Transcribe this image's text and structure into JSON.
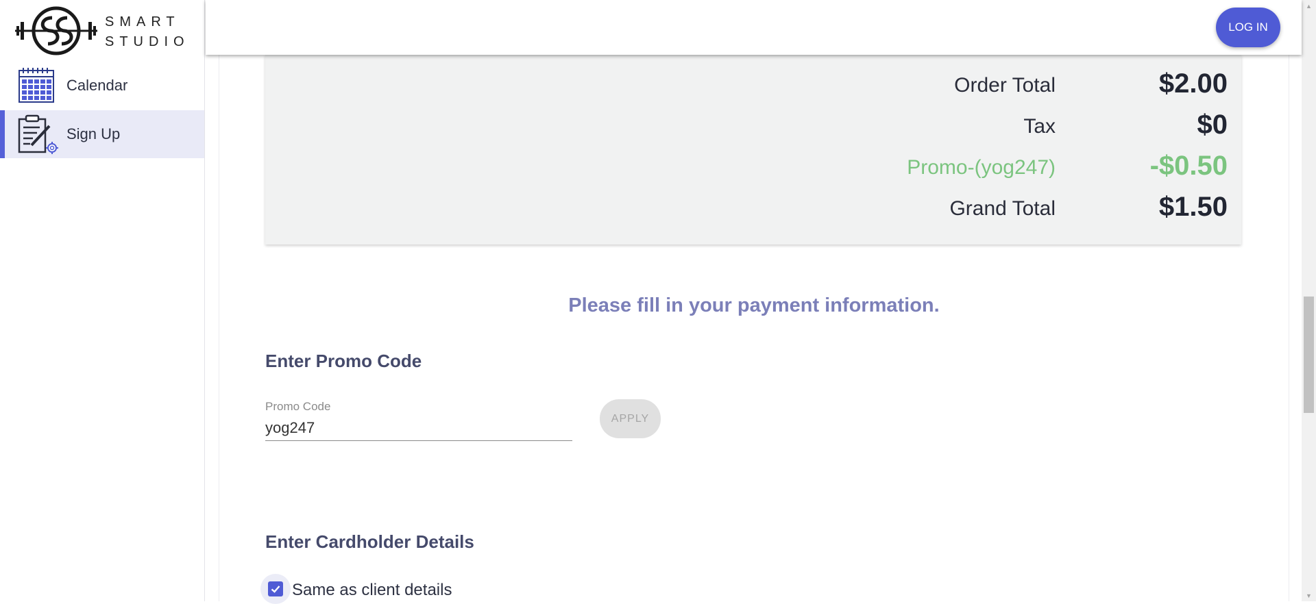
{
  "brand": {
    "logo_text_line1": "SMART",
    "logo_text_line2": "STUDIO"
  },
  "sidebar": {
    "items": [
      {
        "label": "Calendar",
        "icon": "calendar-icon",
        "active": false
      },
      {
        "label": "Sign Up",
        "icon": "clipboard-settings-icon",
        "active": true
      }
    ]
  },
  "header": {
    "login_label": "LOG IN"
  },
  "summary": {
    "order_total_label": "Order Total",
    "order_total_value": "$2.00",
    "tax_label": "Tax",
    "tax_value": "$0",
    "promo_label": "Promo-(yog247)",
    "promo_value": "-$0.50",
    "grand_total_label": "Grand Total",
    "grand_total_value": "$1.50"
  },
  "payment": {
    "title": "Please fill in your payment information.",
    "promo_section_heading": "Enter Promo Code",
    "promo_field_label": "Promo Code",
    "promo_field_value": "yog247",
    "apply_label": "APPLY",
    "cardholder_heading": "Enter Cardholder Details",
    "same_as_client_label": "Same as client details",
    "same_as_client_checked": true
  },
  "colors": {
    "accent": "#4f5bd5",
    "promo_green": "#7bc47f",
    "title_purple": "#7b7fb8",
    "heading_navy": "#454a6b"
  }
}
